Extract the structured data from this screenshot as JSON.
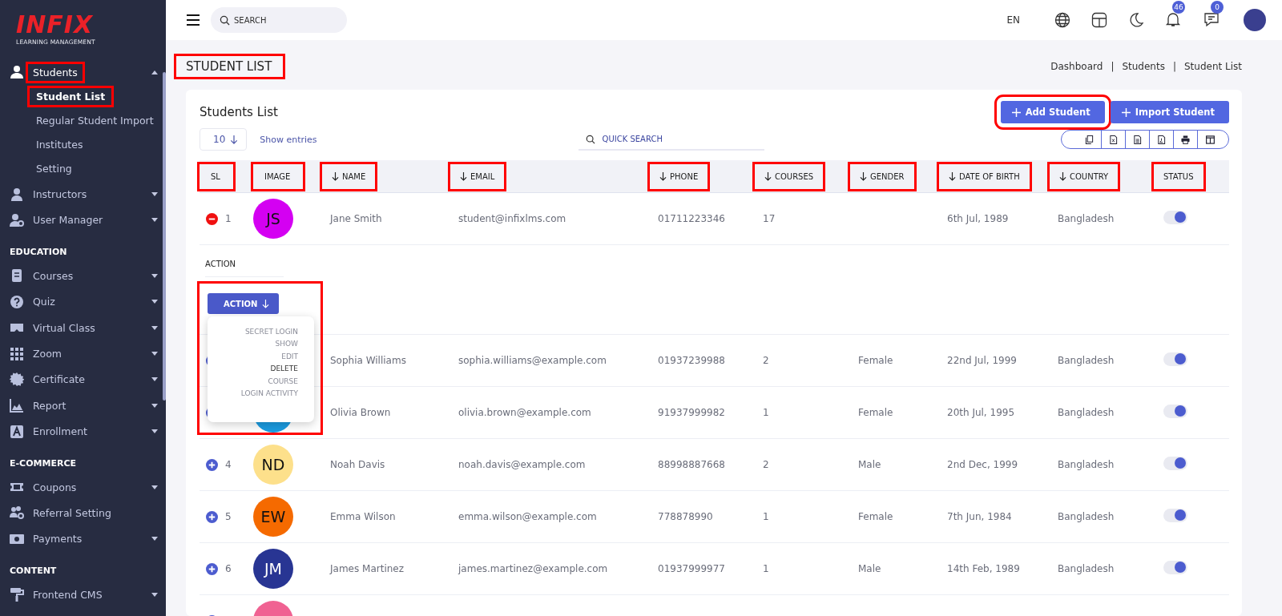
{
  "logo": {
    "title": "INFIX",
    "subtitle": "LEARNING MANAGEMENT"
  },
  "sidebar": {
    "groups": [
      {
        "items": [
          {
            "label": "Students",
            "has_children": true,
            "expanded": true,
            "highlighted": true,
            "children": [
              {
                "label": "Student List",
                "selected": true,
                "highlighted": true
              },
              {
                "label": "Regular Student Import",
                "selected": false,
                "highlighted": false
              },
              {
                "label": "Institutes",
                "selected": false,
                "highlighted": false
              },
              {
                "label": "Setting",
                "selected": false,
                "highlighted": false
              }
            ]
          },
          {
            "label": "Instructors",
            "has_children": true,
            "expanded": false,
            "highlighted": false
          },
          {
            "label": "User Manager",
            "has_children": true,
            "expanded": false,
            "highlighted": false
          }
        ]
      },
      {
        "heading": "EDUCATION",
        "items": [
          {
            "label": "Courses",
            "has_children": true,
            "expanded": false,
            "highlighted": false
          },
          {
            "label": "Quiz",
            "has_children": true,
            "expanded": false,
            "highlighted": false
          },
          {
            "label": "Virtual Class",
            "has_children": true,
            "expanded": false,
            "highlighted": false
          },
          {
            "label": "Zoom",
            "has_children": true,
            "expanded": false,
            "highlighted": false
          },
          {
            "label": "Certificate",
            "has_children": true,
            "expanded": false,
            "highlighted": false
          },
          {
            "label": "Report",
            "has_children": true,
            "expanded": false,
            "highlighted": false
          },
          {
            "label": "Enrollment",
            "has_children": true,
            "expanded": false,
            "highlighted": false
          }
        ]
      },
      {
        "heading": "E-COMMERCE",
        "items": [
          {
            "label": "Coupons",
            "has_children": true,
            "expanded": false,
            "highlighted": false
          },
          {
            "label": "Referral Setting",
            "has_children": false,
            "expanded": false,
            "highlighted": false
          },
          {
            "label": "Payments",
            "has_children": true,
            "expanded": false,
            "highlighted": false
          }
        ]
      },
      {
        "heading": "CONTENT",
        "items": [
          {
            "label": "Frontend CMS",
            "has_children": true,
            "expanded": false,
            "highlighted": false
          }
        ]
      }
    ]
  },
  "topbar": {
    "search": {
      "placeholder": "SEARCH"
    },
    "language": "EN",
    "notifications": {
      "badge": "46"
    },
    "messages": {
      "badge": "0"
    }
  },
  "page": {
    "title": "STUDENT LIST",
    "title_highlighted": true,
    "breadcrumb_separator": "|",
    "breadcrumb": [
      "Dashboard",
      "Students",
      "Student List"
    ]
  },
  "card": {
    "title": "Students List",
    "buttons": [
      {
        "label": "Add Student",
        "highlighted": true
      },
      {
        "label": "Import Student",
        "highlighted": false
      }
    ],
    "page_size": "10",
    "page_size_label": "Show entries",
    "quick_search": {
      "placeholder": "QUICK SEARCH"
    }
  },
  "table": {
    "columns": [
      {
        "label": "SL",
        "sortable": false,
        "highlighted": true
      },
      {
        "label": "IMAGE",
        "sortable": false,
        "highlighted": true
      },
      {
        "label": "NAME",
        "sortable": true,
        "highlighted": true
      },
      {
        "label": "EMAIL",
        "sortable": true,
        "highlighted": true
      },
      {
        "label": "PHONE",
        "sortable": true,
        "highlighted": true
      },
      {
        "label": "COURSES",
        "sortable": true,
        "highlighted": true
      },
      {
        "label": "GENDER",
        "sortable": true,
        "highlighted": true
      },
      {
        "label": "DATE OF BIRTH",
        "sortable": true,
        "highlighted": true
      },
      {
        "label": "COUNTRY",
        "sortable": true,
        "highlighted": true
      },
      {
        "label": "STATUS",
        "sortable": false,
        "highlighted": true
      }
    ],
    "rows": [
      {
        "sl": "1",
        "expanded": true,
        "avatar": {
          "initials": "JS",
          "color": "#d400f2"
        },
        "name": "Jane Smith",
        "email": "student@infixlms.com",
        "phone": "01711223346",
        "courses": "17",
        "date_of_birth": "6th Jul, 1989",
        "country": "Bangladesh",
        "on": true,
        "detail": {
          "label": "ACTION",
          "action_button": "ACTION",
          "highlighted": true,
          "menu": [
            {
              "label": "SECRET LOGIN",
              "selected": false
            },
            {
              "label": "SHOW",
              "selected": false
            },
            {
              "label": "EDIT",
              "selected": false
            },
            {
              "label": "DELETE",
              "selected": true
            },
            {
              "label": "COURSE",
              "selected": false
            },
            {
              "label": "LOGIN ACTIVITY",
              "selected": false
            }
          ]
        }
      },
      {
        "expanded": false,
        "name": "Sophia Williams",
        "email": "sophia.williams@example.com",
        "phone": "01937239988",
        "courses": "2",
        "gender": "Female",
        "date_of_birth": "22nd Jul, 1999",
        "country": "Bangladesh",
        "on": true
      },
      {
        "expanded": false,
        "avatar": {
          "color": "#1b9be0"
        },
        "name": "Olivia Brown",
        "email": "olivia.brown@example.com",
        "phone": "91937999982",
        "courses": "1",
        "gender": "Female",
        "date_of_birth": "20th Jul, 1995",
        "country": "Bangladesh",
        "on": true
      },
      {
        "sl": "4",
        "expanded": false,
        "avatar": {
          "initials": "ND",
          "color": "#fde08b"
        },
        "name": "Noah Davis",
        "email": "noah.davis@example.com",
        "phone": "88998887668",
        "courses": "2",
        "gender": "Male",
        "date_of_birth": "2nd Dec, 1999",
        "country": "Bangladesh",
        "on": true
      },
      {
        "sl": "5",
        "expanded": false,
        "avatar": {
          "initials": "EW",
          "color": "#f56a00"
        },
        "name": "Emma Wilson",
        "email": "emma.wilson@example.com",
        "phone": "778878990",
        "courses": "1",
        "gender": "Female",
        "date_of_birth": "7th Jun, 1984",
        "country": "Bangladesh",
        "on": true
      },
      {
        "sl": "6",
        "expanded": false,
        "avatar": {
          "initials": "JM",
          "color": "#283593"
        },
        "name": "James Martinez",
        "email": "james.martinez@example.com",
        "phone": "01937999977",
        "courses": "1",
        "gender": "Male",
        "date_of_birth": "14th Feb, 1989",
        "country": "Bangladesh",
        "on": true
      },
      {
        "expanded": false,
        "avatar": {
          "color": "#f06292"
        }
      }
    ]
  }
}
